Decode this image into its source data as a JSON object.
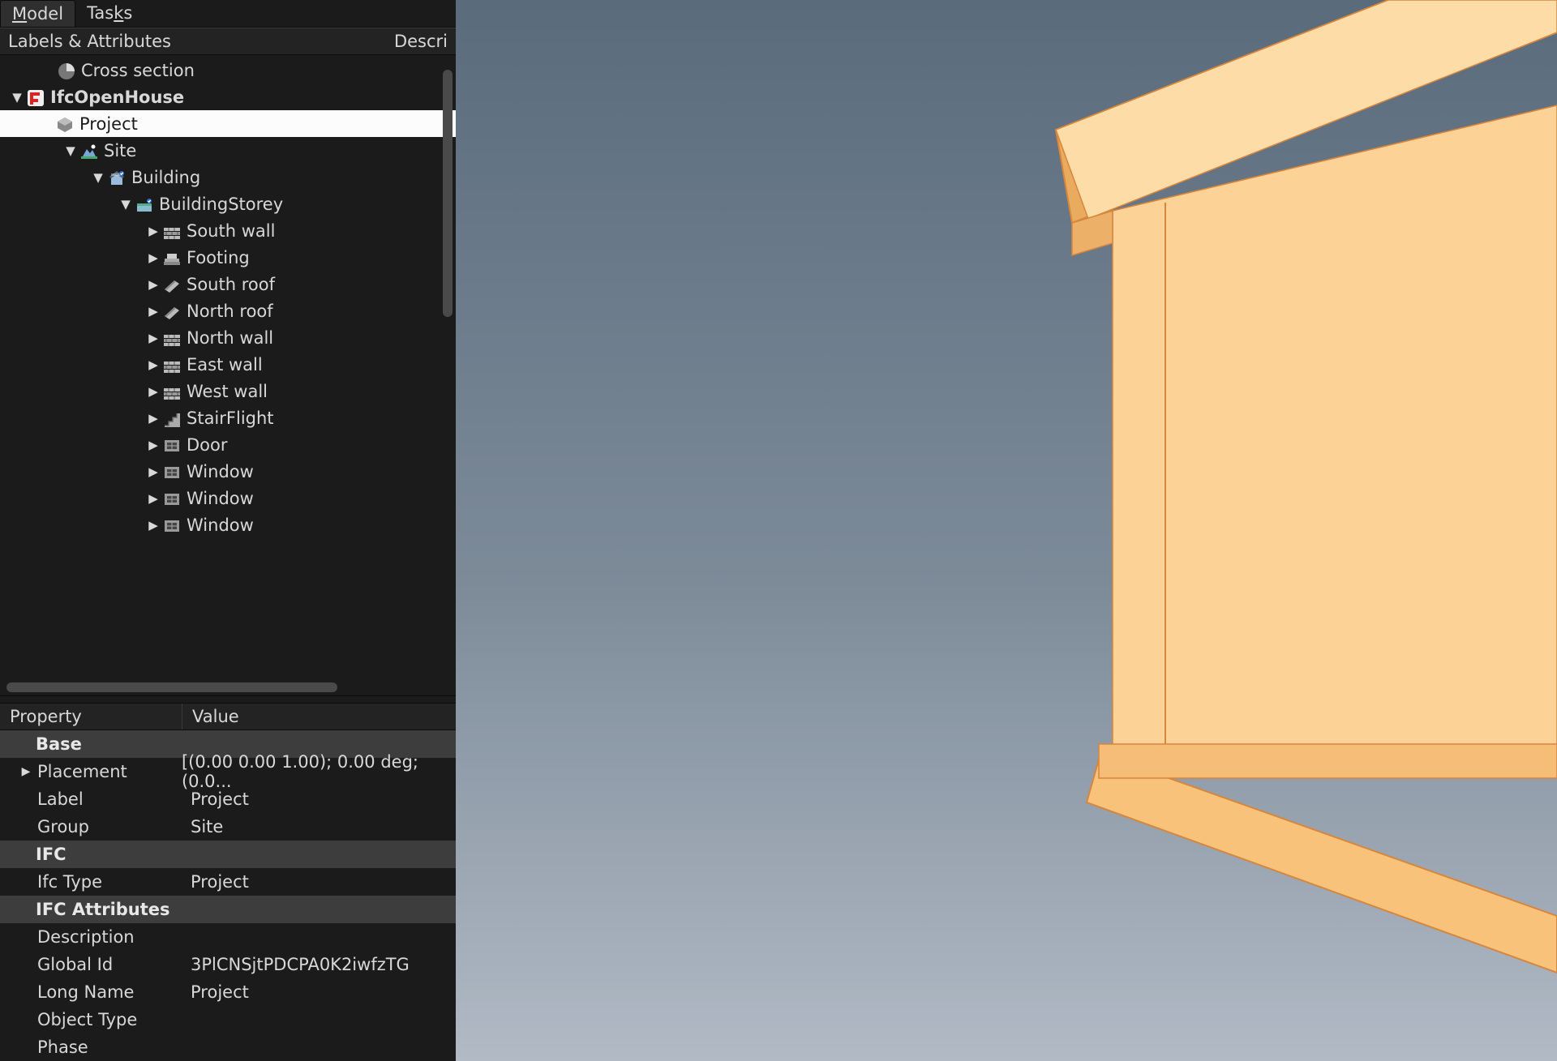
{
  "tabs": {
    "model": "Model",
    "tasks": "Tasks"
  },
  "treeHeader": {
    "col1": "Labels & Attributes",
    "col2": "Descri"
  },
  "tree": {
    "crossSection": "Cross section",
    "root": "IfcOpenHouse",
    "project": "Project",
    "site": "Site",
    "building": "Building",
    "storey": "BuildingStorey",
    "children": [
      {
        "label": "South wall",
        "icon": "wall"
      },
      {
        "label": "Footing",
        "icon": "footing"
      },
      {
        "label": "South roof",
        "icon": "roof"
      },
      {
        "label": "North roof",
        "icon": "roof"
      },
      {
        "label": "North wall",
        "icon": "wall"
      },
      {
        "label": "East wall",
        "icon": "wall"
      },
      {
        "label": "West wall",
        "icon": "wall"
      },
      {
        "label": "StairFlight",
        "icon": "stair"
      },
      {
        "label": "Door",
        "icon": "opening"
      },
      {
        "label": "Window",
        "icon": "opening"
      },
      {
        "label": "Window",
        "icon": "opening"
      },
      {
        "label": "Window",
        "icon": "opening"
      }
    ]
  },
  "propsHeader": {
    "property": "Property",
    "value": "Value"
  },
  "groups": {
    "base": "Base",
    "ifc": "IFC",
    "ifcAttrs": "IFC Attributes"
  },
  "props": {
    "placement": {
      "name": "Placement",
      "value": "[(0.00 0.00 1.00); 0.00 deg; (0.0..."
    },
    "label": {
      "name": "Label",
      "value": "Project"
    },
    "group": {
      "name": "Group",
      "value": "Site"
    },
    "ifcType": {
      "name": "Ifc Type",
      "value": "Project"
    },
    "description": {
      "name": "Description",
      "value": ""
    },
    "globalId": {
      "name": "Global Id",
      "value": "3PlCNSjtPDCPA0K2iwfzTG"
    },
    "longName": {
      "name": "Long Name",
      "value": "Project"
    },
    "objectType": {
      "name": "Object Type",
      "value": ""
    },
    "phase": {
      "name": "Phase",
      "value": ""
    }
  }
}
